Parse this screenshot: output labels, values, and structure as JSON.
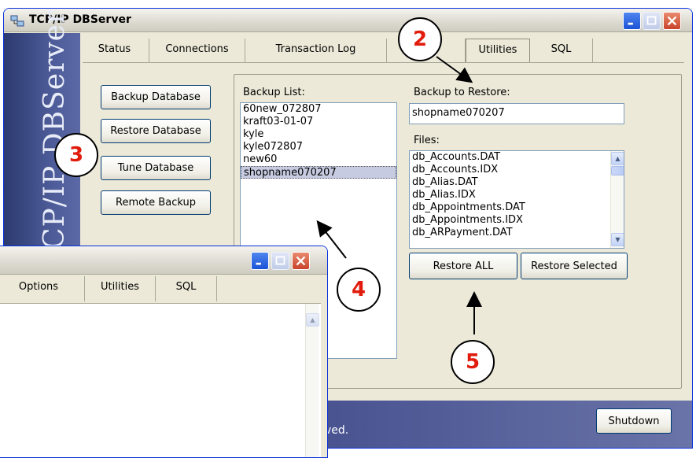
{
  "main_window": {
    "title": "TCP/IP DBServer",
    "sidebar_title": "TCP/IP DBServer",
    "tabs": [
      {
        "label": "Status"
      },
      {
        "label": "Connections"
      },
      {
        "label": "Transaction Log"
      },
      {
        "label": ""
      },
      {
        "label": "Utilities"
      },
      {
        "label": "SQL"
      }
    ],
    "buttons": {
      "backup": "Backup Database",
      "restore": "Restore Database",
      "tune": "Tune Database",
      "remote": "Remote Backup"
    },
    "backup_list_label": "Backup List:",
    "backup_list": [
      "60new_072807",
      "kraft03-01-07",
      "kyle",
      "kyle072807",
      "new60",
      "shopname070207"
    ],
    "backup_list_selected": "shopname070207",
    "restore_label": "Backup to Restore:",
    "restore_value": "shopname070207",
    "files_label": "Files:",
    "files": [
      "db_Accounts.DAT",
      "db_Accounts.IDX",
      "db_Alias.DAT",
      "db_Alias.IDX",
      "db_Appointments.DAT",
      "db_Appointments.IDX",
      "db_ARPayment.DAT"
    ],
    "restore_all": "Restore ALL",
    "restore_selected": "Restore Selected",
    "footer_text": "ved.",
    "shutdown": "Shutdown"
  },
  "second_window": {
    "tabs": [
      {
        "label": "Options"
      },
      {
        "label": "Utilities"
      },
      {
        "label": "SQL"
      }
    ]
  },
  "callouts": {
    "c2": "2",
    "c3": "3",
    "c4": "4",
    "c5": "5"
  }
}
